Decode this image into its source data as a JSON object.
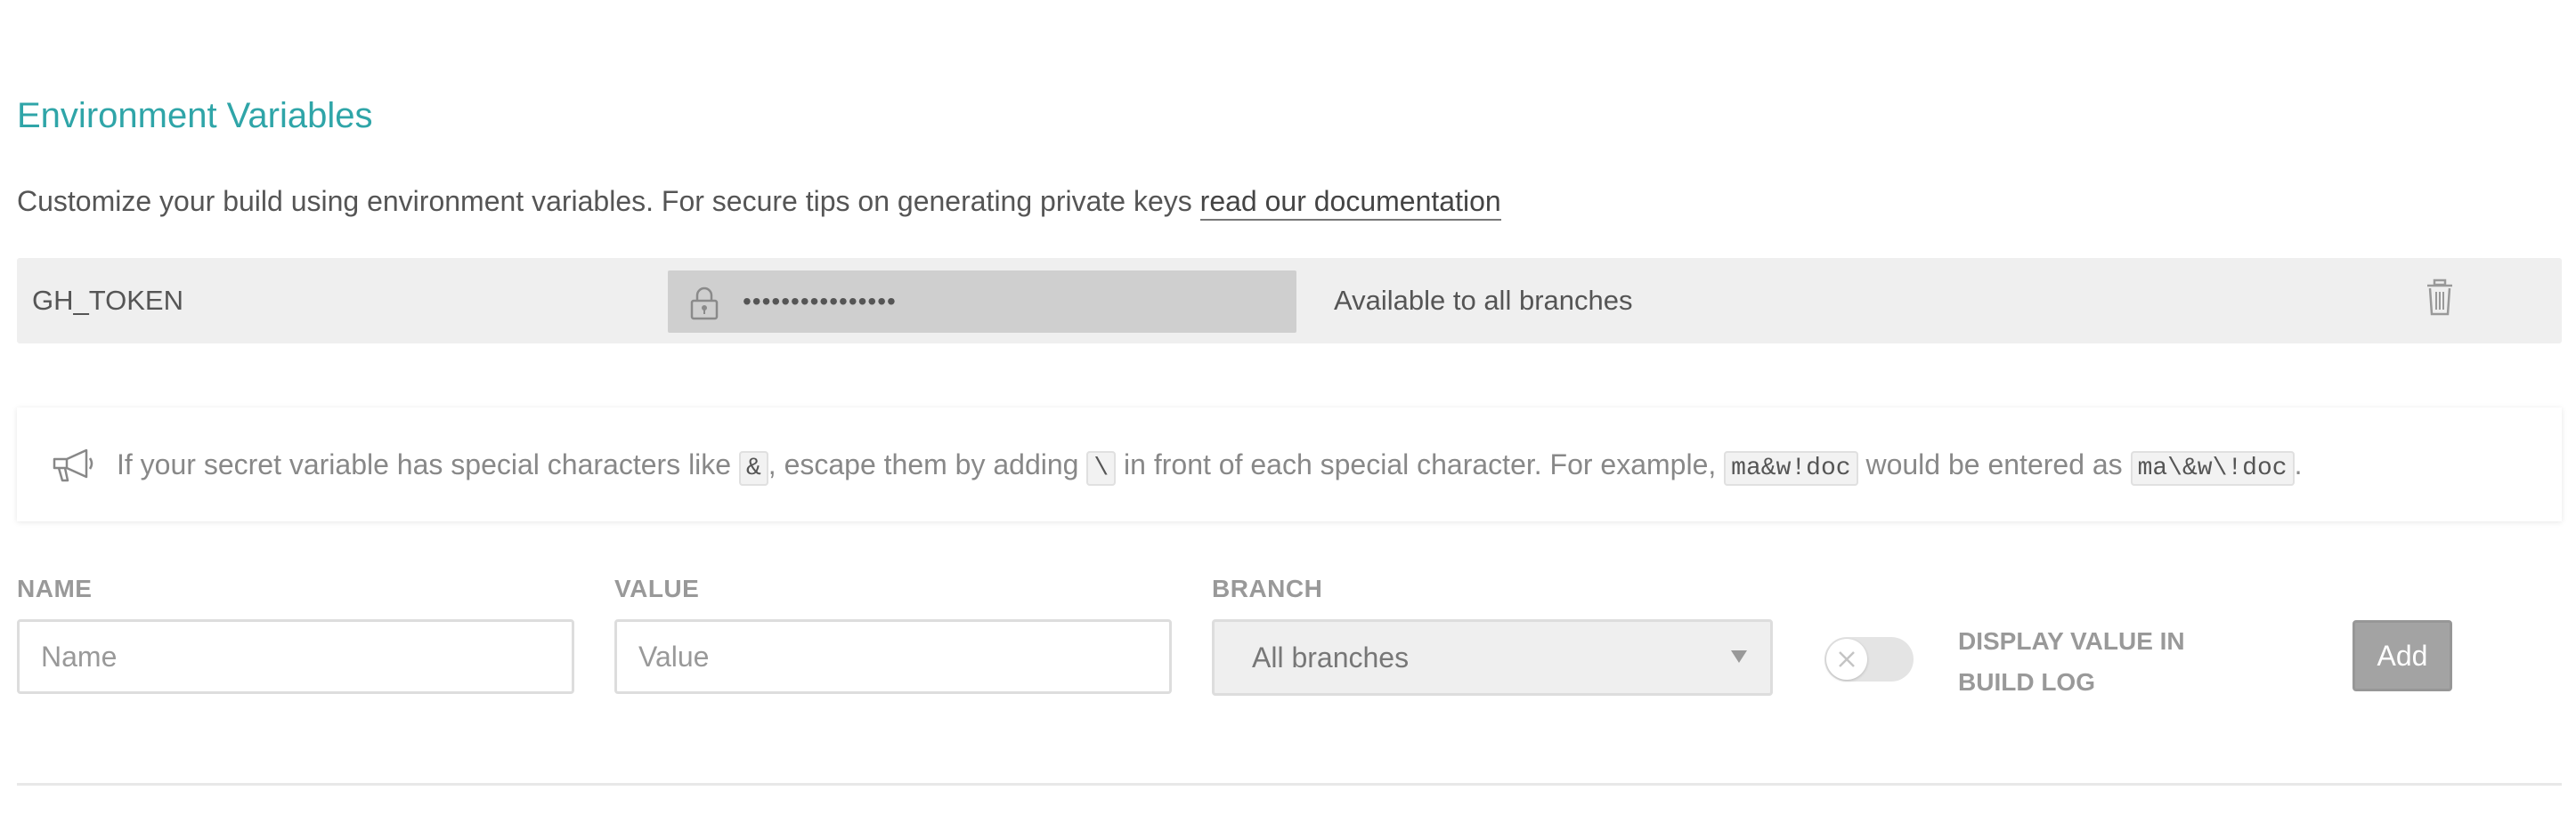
{
  "section": {
    "title": "Environment Variables",
    "intro_text": "Customize your build using environment variables. For secure tips on generating private keys ",
    "intro_link": "read our documentation"
  },
  "variables": [
    {
      "name": "GH_TOKEN",
      "value_masked": "••••••••••••••••",
      "branch": "Available to all branches"
    }
  ],
  "notice": {
    "icon": "megaphone-icon",
    "text_1": "If your secret variable has special characters like ",
    "code_1": "&",
    "text_2": ", escape them by adding ",
    "code_2": "\\",
    "text_3": " in front of each special character. For example, ",
    "code_3": "ma&w!doc",
    "text_4": " would be entered as ",
    "code_4": "ma\\&w\\!doc",
    "text_5": "."
  },
  "form": {
    "name_label": "NAME",
    "name_placeholder": "Name",
    "value_label": "VALUE",
    "value_placeholder": "Value",
    "branch_label": "BRANCH",
    "branch_selected": "All branches",
    "display_toggle_label": "DISPLAY VALUE IN BUILD LOG",
    "display_toggle_on": false,
    "add_button_label": "Add"
  },
  "colors": {
    "accent": "#2fa5a8",
    "row_background": "#efefef",
    "masked_value_background": "#cfcfcf",
    "button_disabled": "#a3a3a3"
  }
}
